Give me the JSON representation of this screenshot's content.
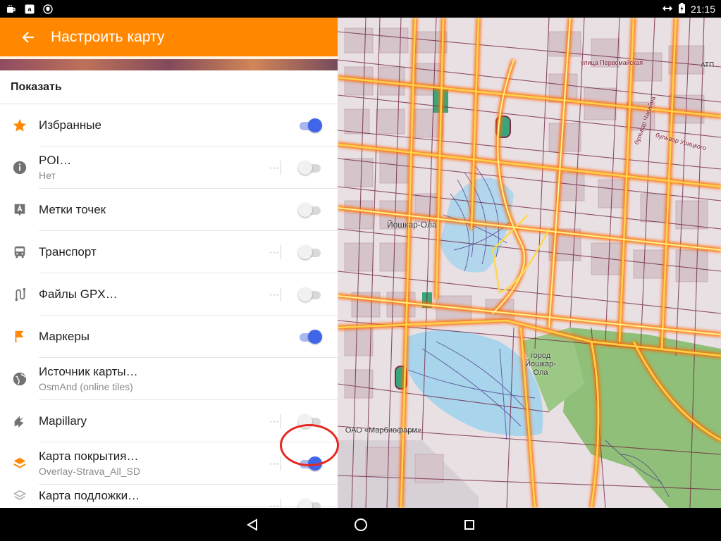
{
  "status_bar": {
    "time": "21:15",
    "left_icons": [
      "cup-icon",
      "amazon-icon",
      "shield-icon"
    ],
    "right_icons": [
      "data-arrows-icon",
      "battery-charging-icon"
    ]
  },
  "app_bar": {
    "title": "Настроить карту",
    "back_icon": "back-arrow-icon",
    "color": "#ff8800"
  },
  "section": {
    "title": "Показать"
  },
  "items": [
    {
      "label": "Избранные",
      "sub": "",
      "icon": "star-icon",
      "icon_color": "#ff8800",
      "has_more": false,
      "toggle": "on"
    },
    {
      "label": "POI…",
      "sub": "Нет",
      "icon": "info-icon",
      "icon_color": "#727272",
      "has_more": true,
      "toggle": "off"
    },
    {
      "label": "Метки точек",
      "sub": "",
      "icon": "map-label-icon",
      "icon_color": "#727272",
      "has_more": false,
      "toggle": "off"
    },
    {
      "label": "Транспорт",
      "sub": "",
      "icon": "bus-icon",
      "icon_color": "#727272",
      "has_more": true,
      "toggle": "off"
    },
    {
      "label": "Файлы GPX…",
      "sub": "",
      "icon": "route-icon",
      "icon_color": "#727272",
      "has_more": true,
      "toggle": "off"
    },
    {
      "label": "Маркеры",
      "sub": "",
      "icon": "flag-icon",
      "icon_color": "#ff8800",
      "has_more": false,
      "toggle": "on"
    },
    {
      "label": "Источник карты…",
      "sub": "OsmAnd (online tiles)",
      "icon": "globe-icon",
      "icon_color": "#727272",
      "has_more": false,
      "toggle": "none"
    },
    {
      "label": "Mapillary",
      "sub": "",
      "icon": "mapillary-icon",
      "icon_color": "#727272",
      "has_more": true,
      "toggle": "off"
    },
    {
      "label": "Карта покрытия…",
      "sub": "Overlay-Strava_All_SD",
      "icon": "layers-icon",
      "icon_color": "#ff8800",
      "has_more": true,
      "toggle": "on"
    },
    {
      "label": "Карта подложки…",
      "sub": "",
      "icon": "layers-outline-icon",
      "icon_color": "#b0b0b0",
      "has_more": true,
      "toggle": "off"
    }
  ],
  "map_labels": {
    "city_1": "Йошкар-Ола",
    "city_2": "город Йошкар-Ола",
    "company": "ОАО «Марбиофарм»",
    "street_1": "улица Первомайская",
    "street_2": "бульвар Чавайна",
    "street_3": "бульвар Урицкого",
    "atp": "АТП"
  },
  "nav_bar": {
    "buttons": [
      "back-triangle-icon",
      "home-circle-icon",
      "recents-square-icon"
    ]
  }
}
